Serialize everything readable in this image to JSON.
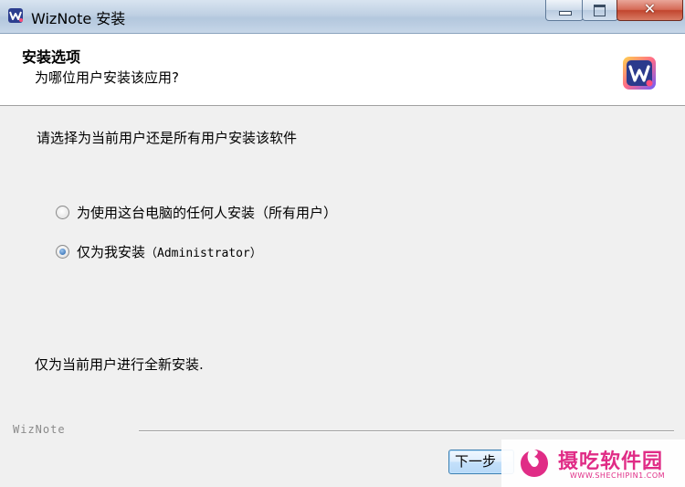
{
  "window": {
    "title": "WizNote 安装",
    "controls": {
      "minimize_icon": "minimize-icon",
      "maximize_icon": "maximize-icon",
      "close_glyph": "✕"
    }
  },
  "header": {
    "title": "安装选项",
    "subtitle": "为哪位用户安装该应用?",
    "logo_icon": "wiznote-logo-icon"
  },
  "body": {
    "instruction": "请选择为当前用户还是所有用户安装该软件",
    "options": [
      {
        "label_main": "为使用这台电脑的任何人安装",
        "label_suffix": "（所有用户）",
        "selected": false
      },
      {
        "label_main": "仅为我安装",
        "label_suffix": "（Administrator）",
        "selected": true
      }
    ],
    "description": "仅为当前用户进行全新安装."
  },
  "footer": {
    "brand": "WizNote",
    "next_label": "下一步"
  },
  "watermark": {
    "title": "摄吃软件园",
    "url": "WWW.SHECHIPIN1.COM"
  },
  "colors": {
    "accent": "#3c7fb1",
    "radio_selected": "#1f5ea8",
    "watermark": "#e02c86"
  }
}
